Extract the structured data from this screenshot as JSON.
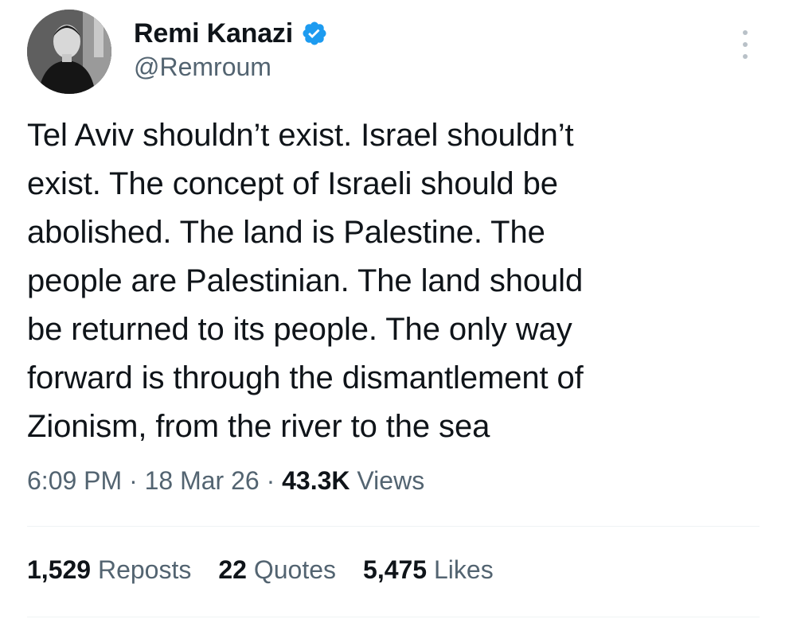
{
  "author": {
    "name": "Remi Kanazi",
    "handle": "@Remroum",
    "verified": true,
    "verified_color": "#1d9bf0"
  },
  "icons": {
    "more": "more-options-icon",
    "verified": "verified-badge-icon"
  },
  "tweet": {
    "lines": [
      "Tel Aviv shouldn’t exist. Israel shouldn’t",
      "exist. The concept of Israeli should be",
      "abolished. The land is Palestine. The",
      "people are Palestinian. The land should",
      "be returned to its people. The only way",
      "forward is through the dismantlement of",
      "Zionism, from the river to the sea"
    ]
  },
  "meta": {
    "time": "6:09 PM",
    "separator": "·",
    "date": "18 Mar 26",
    "views_count": "43.3K",
    "views_label": "Views"
  },
  "stats": {
    "reposts_count": "1,529",
    "reposts_label": "Reposts",
    "quotes_count": "22",
    "quotes_label": "Quotes",
    "likes_count": "5,475",
    "likes_label": "Likes"
  },
  "colors": {
    "text_primary": "#0f1419",
    "text_secondary": "#536471",
    "divider": "#eff3f4"
  }
}
